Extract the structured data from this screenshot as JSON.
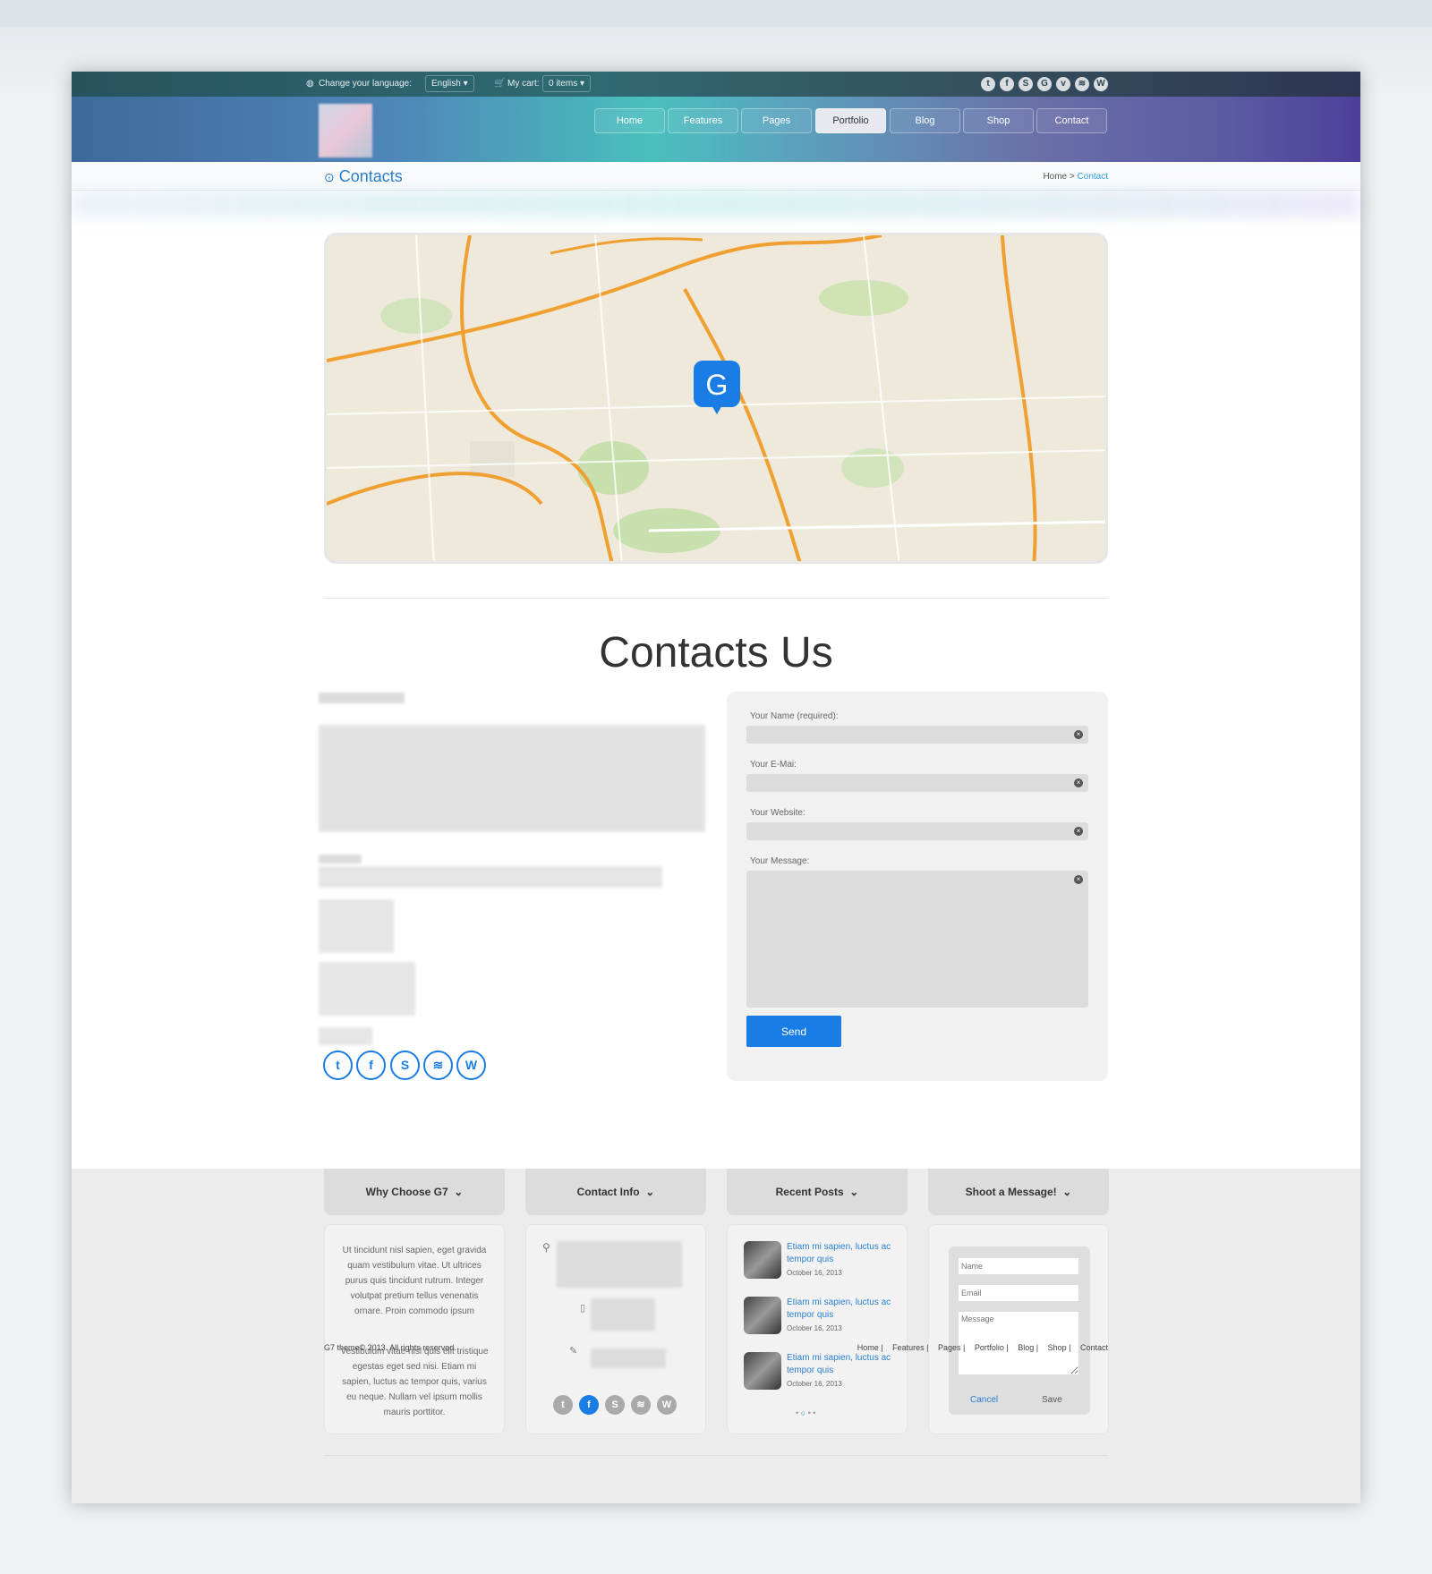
{
  "topbar": {
    "language_label": "Change your language:",
    "language_value": "English",
    "cart_label": "My cart:",
    "cart_value": "0 items",
    "social": [
      "twitter",
      "facebook",
      "skype",
      "google-plus",
      "vimeo",
      "rss",
      "wordpress"
    ]
  },
  "nav": [
    {
      "label": "Home"
    },
    {
      "label": "Features"
    },
    {
      "label": "Pages"
    },
    {
      "label": "Portfolio",
      "active": true
    },
    {
      "label": "Blog"
    },
    {
      "label": "Shop"
    },
    {
      "label": "Contact"
    }
  ],
  "breadcrumb": {
    "title": "Contacts",
    "home": "Home",
    "sep": ">",
    "current": "Contact"
  },
  "main": {
    "heading": "Contacts Us"
  },
  "form": {
    "name_label": "Your Name (required):",
    "email_label": "Your E-Mai:",
    "website_label": "Your Website:",
    "message_label": "Your Message:",
    "send": "Send"
  },
  "footer": {
    "widgets": [
      "Why Choose G7",
      "Contact Info",
      "Recent Posts",
      "Shoot a Message!"
    ],
    "why_p1": "Ut tincidunt nisl sapien, eget gravida quam vestibulum vitae. Ut ultrices purus quis tincidunt rutrum. Integer volutpat pretium tellus venenatis ornare. Proin commodo ipsum",
    "why_p2": "Vestibulum vitae nisl quis elit tristique egestas eget sed nisi. Etiam mi sapien, luctus ac tempor quis, varius eu neque. Nullam vel ipsum mollis mauris porttitor.",
    "posts": [
      {
        "title": "Etiam mi sapien, luctus ac tempor quis",
        "date": "October 16, 2013"
      },
      {
        "title": "Etiam mi sapien, luctus ac tempor quis",
        "date": "October 16, 2013"
      },
      {
        "title": "Etiam mi sapien, luctus ac tempor quis",
        "date": "October 16, 2013"
      }
    ],
    "msg": {
      "name_ph": "Name",
      "email_ph": "Email",
      "message_ph": "Message",
      "cancel": "Cancel",
      "save": "Save"
    },
    "copyright": "G7 theme© 2013. All rights reserved.",
    "links": [
      "Home",
      "Features",
      "Pages",
      "Portfolio",
      "Blog",
      "Shop",
      "Contact"
    ]
  },
  "colors": {
    "accent": "#1a7de6"
  }
}
